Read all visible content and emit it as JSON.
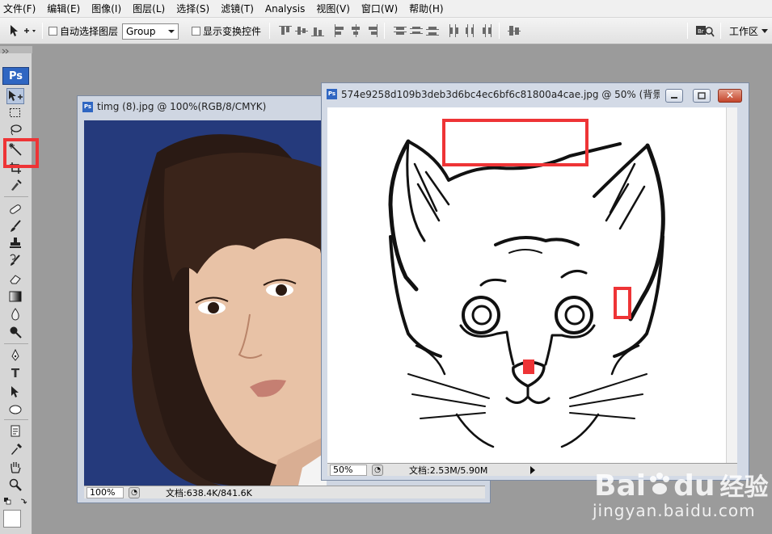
{
  "menu": [
    "文件(F)",
    "编辑(E)",
    "图像(I)",
    "图层(L)",
    "选择(S)",
    "滤镜(T)",
    "Analysis",
    "视图(V)",
    "窗口(W)",
    "帮助(H)"
  ],
  "options": {
    "auto_select_label": "自动选择图层",
    "auto_select_value": "Group",
    "show_transform_label": "显示变换控件",
    "workspace_label": "工作区"
  },
  "toolbox": {
    "logo": "Ps"
  },
  "doc1": {
    "title": "timg (8).jpg @ 100%(RGB/8/CMYK)",
    "zoom": "100%",
    "status": "文档:638.4K/841.6K"
  },
  "doc2": {
    "title": "574e9258d109b3deb3d6bc4ec6bf6c81800a4cae.jpg @ 50% (背景...",
    "zoom": "50%",
    "status": "文档:2.53M/5.90M"
  },
  "watermark": {
    "brand": "Bai",
    "brand2": "du",
    "brand3": "经验",
    "url": "jingyan.baidu.com"
  },
  "colors": {
    "highlight": "#ee3436",
    "ps_blue": "#2f66c2",
    "photo_bg": "#253a7c"
  }
}
